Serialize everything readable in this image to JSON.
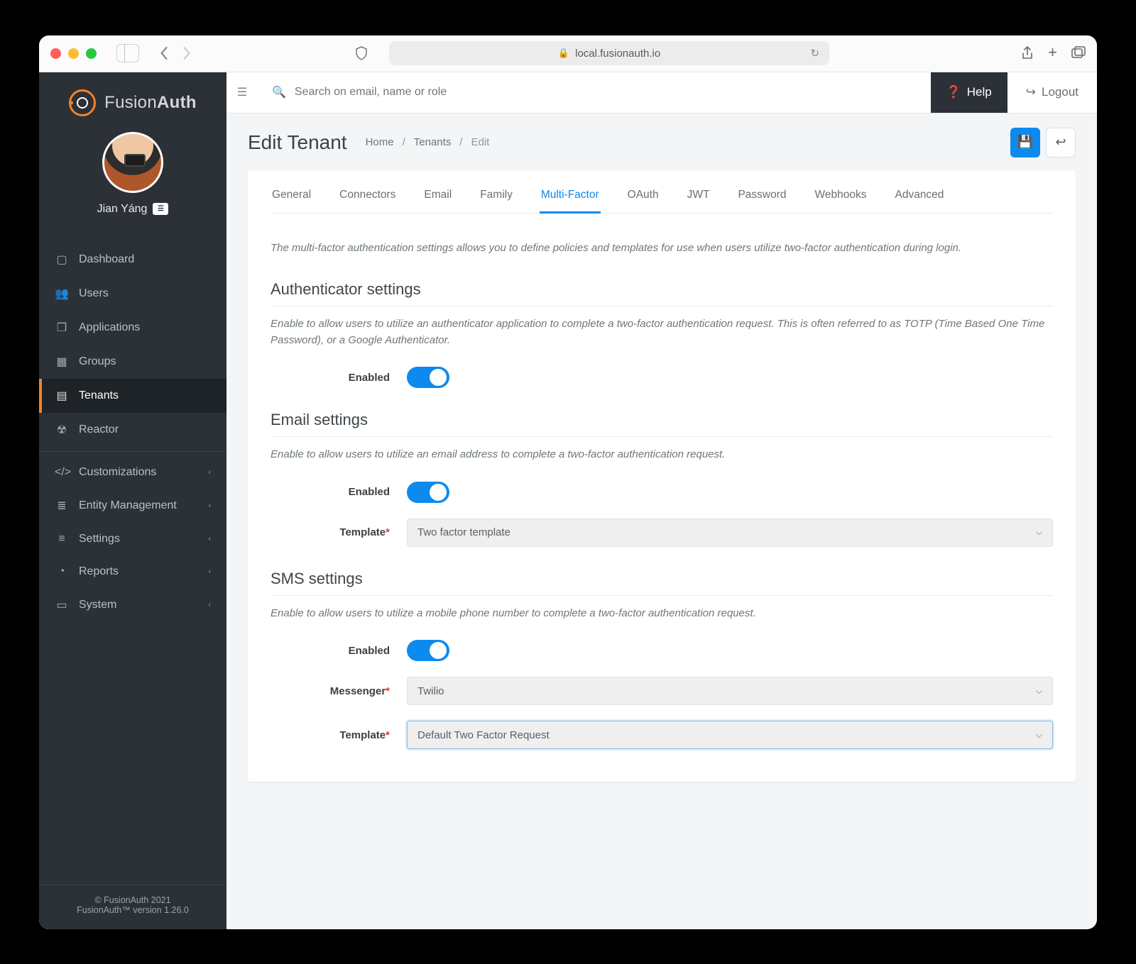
{
  "browser": {
    "url": "local.fusionauth.io"
  },
  "brand": {
    "name_a": "Fusion",
    "name_b": "Auth"
  },
  "user": {
    "name": "Jian Yáng"
  },
  "sidebar": {
    "items": [
      {
        "label": "Dashboard",
        "icon": "▢"
      },
      {
        "label": "Users",
        "icon": "⚑"
      },
      {
        "label": "Applications",
        "icon": "❒"
      },
      {
        "label": "Groups",
        "icon": "▦"
      },
      {
        "label": "Tenants",
        "icon": "▤",
        "active": true
      },
      {
        "label": "Reactor",
        "icon": "☢"
      }
    ],
    "groups": [
      {
        "label": "Customizations",
        "icon": "</>"
      },
      {
        "label": "Entity Management",
        "icon": "≣"
      },
      {
        "label": "Settings",
        "icon": "⚙"
      },
      {
        "label": "Reports",
        "icon": "◔"
      },
      {
        "label": "System",
        "icon": "▭"
      }
    ]
  },
  "footer": {
    "line1": "© FusionAuth 2021",
    "line2": "FusionAuth™ version 1.26.0"
  },
  "topbar": {
    "search_placeholder": "Search on email, name or role",
    "help": "Help",
    "logout": "Logout"
  },
  "page": {
    "title": "Edit Tenant",
    "crumbs": [
      "Home",
      "Tenants",
      "Edit"
    ]
  },
  "tabs": [
    "General",
    "Connectors",
    "Email",
    "Family",
    "Multi-Factor",
    "OAuth",
    "JWT",
    "Password",
    "Webhooks",
    "Advanced"
  ],
  "active_tab": "Multi-Factor",
  "mfa": {
    "intro": "The multi-factor authentication settings allows you to define policies and templates for use when users utilize two-factor authentication during login.",
    "auth": {
      "title": "Authenticator settings",
      "desc": "Enable to allow users to utilize an authenticator application to complete a two-factor authentication request. This is often referred to as TOTP (Time Based One Time Password), or a Google Authenticator.",
      "enabled_label": "Enabled"
    },
    "email": {
      "title": "Email settings",
      "desc": "Enable to allow users to utilize an email address to complete a two-factor authentication request.",
      "enabled_label": "Enabled",
      "template_label": "Template",
      "template_value": "Two factor template"
    },
    "sms": {
      "title": "SMS settings",
      "desc": "Enable to allow users to utilize a mobile phone number to complete a two-factor authentication request.",
      "enabled_label": "Enabled",
      "messenger_label": "Messenger",
      "messenger_value": "Twilio",
      "template_label": "Template",
      "template_value": "Default Two Factor Request"
    }
  }
}
